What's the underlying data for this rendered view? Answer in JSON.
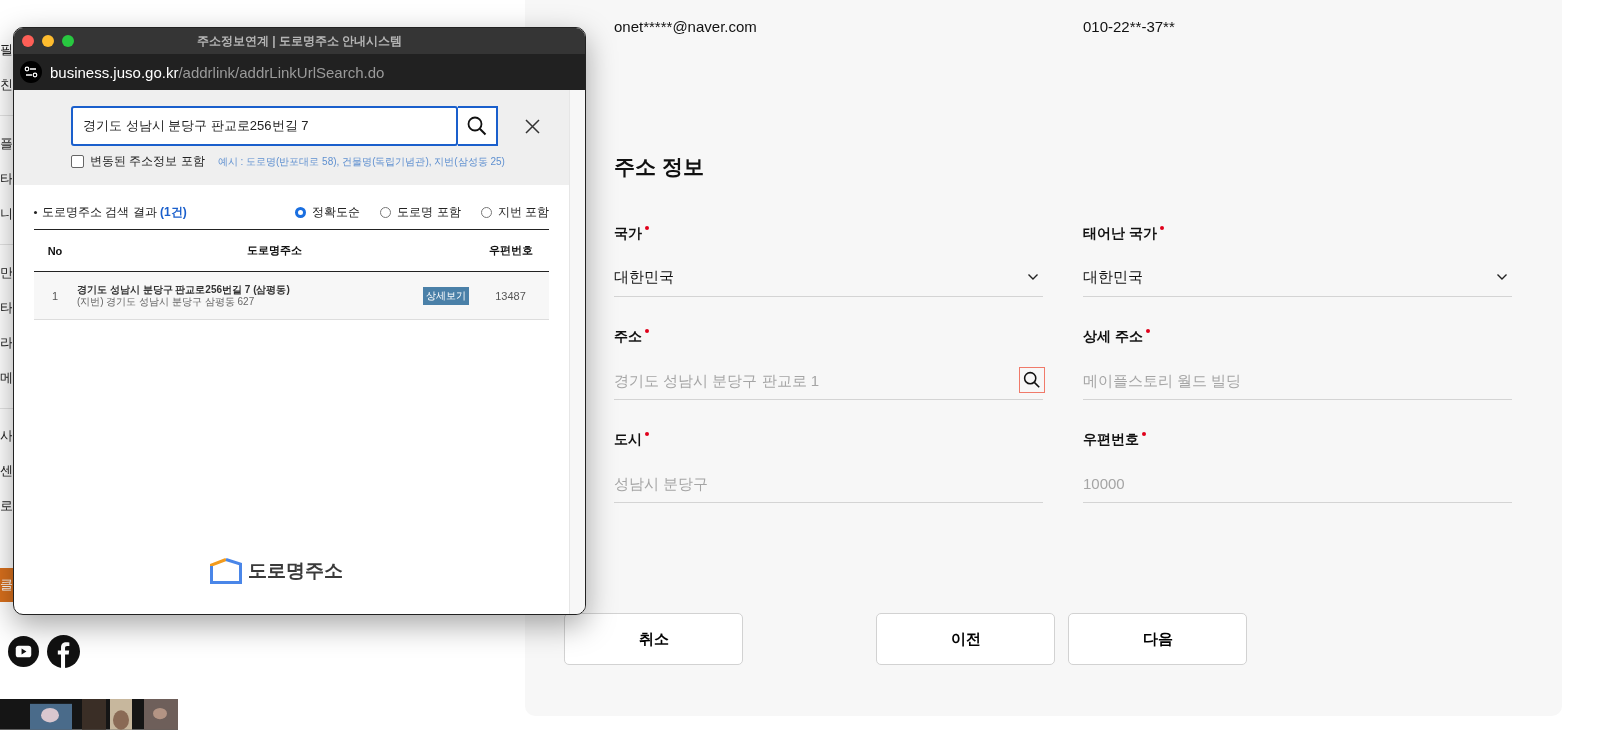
{
  "sidebar": {
    "groups": [
      [
        "필",
        "친"
      ],
      [
        "플",
        "타",
        "니"
      ],
      [
        "만",
        "타",
        "라",
        "메"
      ],
      [
        "사",
        "센",
        "로"
      ]
    ],
    "button": "클"
  },
  "contact": {
    "email": "onet*****@naver.com",
    "phone": "010-22**-37**"
  },
  "section_title": "주소 정보",
  "fields": [
    {
      "label": "국가",
      "required": true,
      "kind": "select",
      "value": "대한민국"
    },
    {
      "label": "태어난 국가",
      "required": true,
      "kind": "select",
      "value": "대한민국"
    },
    {
      "label": "주소",
      "required": true,
      "kind": "search",
      "placeholder": "경기도 성남시 분당구 판교로 1"
    },
    {
      "label": "상세 주소",
      "required": true,
      "kind": "text",
      "placeholder": "메이플스토리 월드 빌딩"
    },
    {
      "label": "도시",
      "required": true,
      "kind": "text",
      "placeholder": "성남시 분당구"
    },
    {
      "label": "우편번호",
      "required": true,
      "kind": "text",
      "placeholder": "10000"
    }
  ],
  "buttons": [
    "취소",
    "이전",
    "다음"
  ],
  "popup": {
    "title": "주소정보연계 | 도로명주소 안내시스템",
    "url_host": "business.juso.go.kr",
    "url_path": "/addrlink/addrLinkUrlSearch.do",
    "search_value": "경기도 성남시 분당구 판교로256번길 7",
    "include_changed": {
      "label": "변동된 주소정보 포함",
      "checked": false
    },
    "example": "예시 : 도로명(반포대로 58), 건물명(독립기념관), 지번(삼성동 25)",
    "result_label": "도로명주소 검색 결과",
    "result_count": "(1건)",
    "sort_options": [
      {
        "label": "정확도순",
        "selected": true
      },
      {
        "label": "도로명 포함",
        "selected": false
      },
      {
        "label": "지번 포함",
        "selected": false
      }
    ],
    "columns": [
      "No",
      "도로명주소",
      "우편번호"
    ],
    "rows": [
      {
        "no": "1",
        "road": "경기도 성남시 분당구 판교로256번길 7 (삼평동)",
        "jibun": "(지번) 경기도 성남시 분당구 삼평동 627",
        "detail_button": "상세보기",
        "zip": "13487"
      }
    ],
    "logo_text": "도로명주소"
  }
}
